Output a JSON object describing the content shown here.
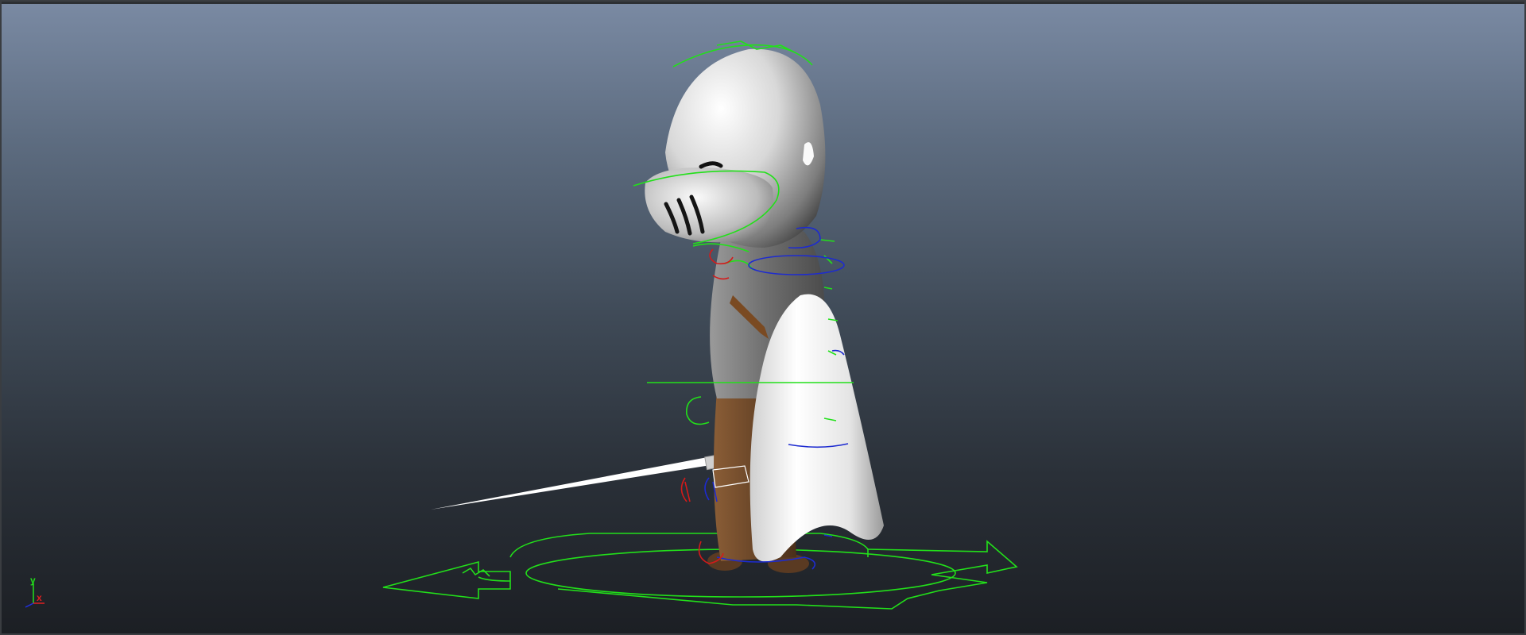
{
  "viewport": {
    "background_top": "#7a8aa3",
    "background_bottom": "#1c1f24"
  },
  "colors": {
    "control_green": "#22e01a",
    "control_blue": "#1d2bd0",
    "control_red": "#d41a1a",
    "armor": "#e6e6e6",
    "tunic": "#6b4a2e",
    "belt": "#7a4a22"
  },
  "axis_gizmo": {
    "y_label": "y",
    "x_label": "x",
    "y_color": "#22e01a",
    "x_color": "#e02020",
    "z_color": "#2030e0"
  },
  "character": {
    "icon": "knight-character",
    "weapon_icon": "sword-icon",
    "shield_icon": "shield-icon"
  }
}
